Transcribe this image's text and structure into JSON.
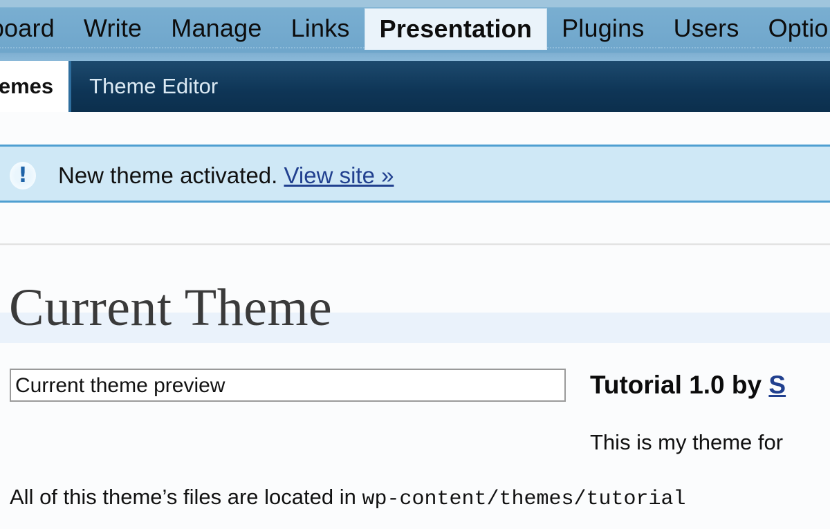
{
  "topnav": {
    "items": [
      {
        "label": "Dashboard",
        "active": false
      },
      {
        "label": "Write",
        "active": false
      },
      {
        "label": "Manage",
        "active": false
      },
      {
        "label": "Links",
        "active": false
      },
      {
        "label": "Presentation",
        "active": true
      },
      {
        "label": "Plugins",
        "active": false
      },
      {
        "label": "Users",
        "active": false
      },
      {
        "label": "Options",
        "active": false
      }
    ],
    "bg_color": "#6fa6cb",
    "active_bg_color": "#eaf3fa"
  },
  "subnav": {
    "items": [
      {
        "label": "Themes",
        "active": true
      },
      {
        "label": "Theme Editor",
        "active": false
      }
    ],
    "bg_color": "#0e3556",
    "active_bg_color": "#ffffff"
  },
  "notice": {
    "icon": "exclamation-icon",
    "icon_glyph": "!",
    "message": "New theme activated.",
    "link_label": "View site »",
    "bg_color": "#cfe8f6",
    "border_color": "#4f9fd1",
    "link_color": "#21408f"
  },
  "page": {
    "title": "Current Theme",
    "title_band_color": "#eaf2fb"
  },
  "preview": {
    "alt_text": "Current theme preview",
    "border_color": "#9a9a9a"
  },
  "theme": {
    "name_version": "Tutorial 1.0 by",
    "author_partial": "S",
    "description": "This is my theme for",
    "files_prefix": "All of this theme’s files are located in",
    "files_path": "wp-content/themes/tutorial"
  }
}
